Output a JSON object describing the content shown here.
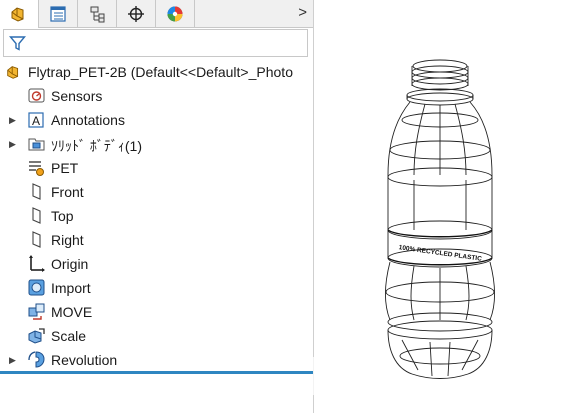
{
  "tabs": [
    {
      "name": "featuremanager-tab",
      "icon": "featuremanager-icon"
    },
    {
      "name": "propertymanager-tab",
      "icon": "propertymanager-icon"
    },
    {
      "name": "configurationmanager-tab",
      "icon": "configurationmanager-icon"
    },
    {
      "name": "dimxpert-tab",
      "icon": "dimxpert-icon"
    },
    {
      "name": "display-manager-tab",
      "icon": "display-manager-icon"
    }
  ],
  "tab_more_label": ">",
  "root": {
    "label": "Flytrap_PET-2B  (Default<<Default>_Photo"
  },
  "tree": [
    {
      "label": "Sensors",
      "icon": "sensors-icon",
      "expandable": false
    },
    {
      "label": "Annotations",
      "icon": "annotations-icon",
      "expandable": true
    },
    {
      "label": "ｿﾘｯﾄﾞ ﾎﾞﾃﾞｨ(1)",
      "icon": "solid-bodies-icon",
      "expandable": true
    },
    {
      "label": "PET",
      "icon": "material-icon",
      "expandable": false
    },
    {
      "label": "Front",
      "icon": "plane-icon",
      "expandable": false
    },
    {
      "label": "Top",
      "icon": "plane-icon",
      "expandable": false
    },
    {
      "label": "Right",
      "icon": "plane-icon",
      "expandable": false
    },
    {
      "label": "Origin",
      "icon": "origin-icon",
      "expandable": false
    },
    {
      "label": "Import",
      "icon": "imported-body-icon",
      "expandable": false
    },
    {
      "label": "MOVE",
      "icon": "move-copy-icon",
      "expandable": false
    },
    {
      "label": "Scale",
      "icon": "scale-icon",
      "expandable": false
    },
    {
      "label": "Revolution",
      "icon": "revolve-icon",
      "expandable": true
    }
  ],
  "bottle": {
    "label_text": "100% RECYCLED PLASTIC"
  },
  "colors": {
    "accent": "#2e86c1",
    "icon_orange": "#f2a21b",
    "icon_blue": "#2b6cb0"
  }
}
